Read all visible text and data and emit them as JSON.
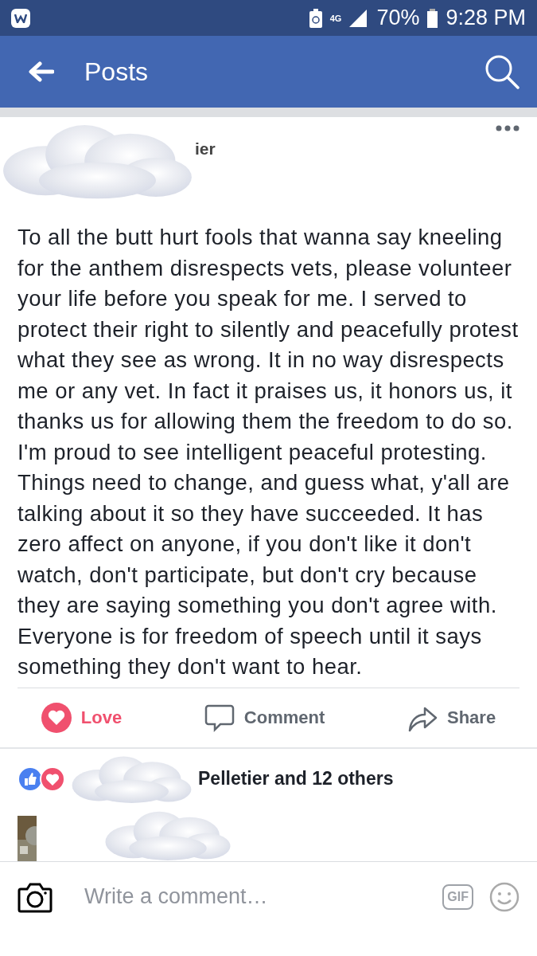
{
  "status_bar": {
    "battery_percent": "70%",
    "time": "9:28 PM",
    "network": "4G"
  },
  "app_bar": {
    "title": "Posts"
  },
  "post": {
    "author_fragment": "ier",
    "body": "To all the butt hurt fools that wanna say kneeling for the anthem disrespects vets, please volunteer your life before you speak for me. I served to protect their right to silently and peacefully protest what they see as wrong. It in no way disrespects me or any vet. In fact it praises us, it honors us, it thanks us for allowing them the freedom to do so. I'm proud to see intelligent peaceful protesting. Things need to change, and guess what, y'all are talking about it so they have succeeded. It has zero affect on anyone, if you don't like it don't watch, don't participate, but don't cry because they are saying something you don't agree with. Everyone is for freedom of speech until it says something they don't want to hear.",
    "actions": [
      {
        "kind": "love",
        "label": "Love",
        "selected": true
      },
      {
        "kind": "comment",
        "label": "Comment",
        "selected": false
      },
      {
        "kind": "share",
        "label": "Share",
        "selected": false
      }
    ],
    "reactions": {
      "rest": "Pelletier and 12 others"
    }
  },
  "comment_box": {
    "placeholder": "Write a comment…",
    "gif_label": "GIF"
  }
}
